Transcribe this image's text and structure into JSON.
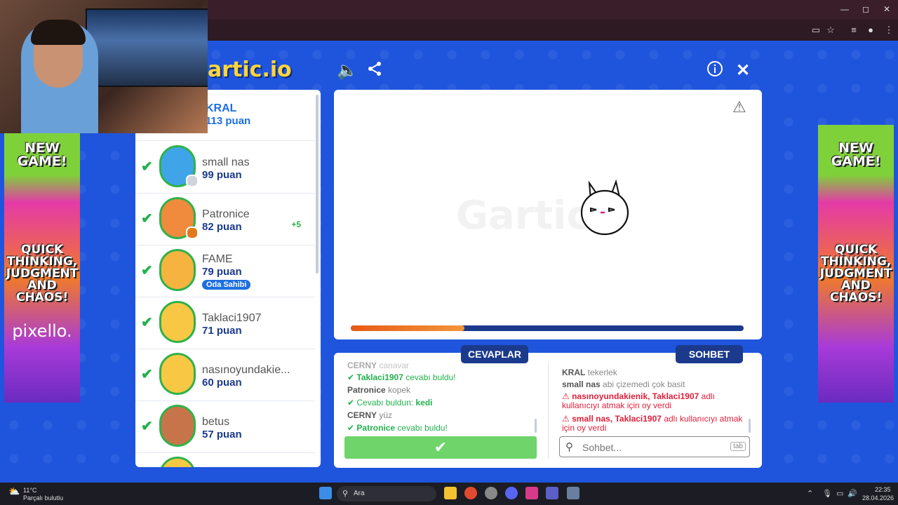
{
  "window": {
    "minimize": "—",
    "maximize": "◻",
    "close": "✕"
  },
  "browser": {
    "icons": [
      "cast-icon",
      "star-icon",
      "menu-icon"
    ]
  },
  "ads": {
    "left": {
      "headline": "NEW GAME!",
      "tagline": "QUICK THINKING, JUDGMENT AND CHAOS!",
      "brand": "pixello."
    },
    "right": {
      "headline": "NEW GAME!",
      "tagline": "QUICK THINKING, JUDGMENT AND CHAOS!"
    }
  },
  "game": {
    "logo": "artic.io",
    "watermark": "Gartic",
    "progress_fraction": 0.29
  },
  "players": [
    {
      "name": "KRAL",
      "score": "113 puan",
      "partial": true
    },
    {
      "name": "small nas",
      "score": "99 puan",
      "checked": true,
      "avatar_color": "#3fa5e8",
      "dot": "#cfd4dc"
    },
    {
      "name": "Patronice",
      "score": "82 puan",
      "checked": true,
      "plus": "+5",
      "avatar_color": "#f08a3c",
      "dot": "#e07a1a"
    },
    {
      "name": "FAME",
      "score": "79 puan",
      "checked": true,
      "owner": "Oda Sahibi",
      "avatar_color": "#f6b340"
    },
    {
      "name": "Taklaci1907",
      "score": "71 puan",
      "checked": true,
      "avatar_color": "#f8c844"
    },
    {
      "name": "nasınoyundakie...",
      "score": "60 puan",
      "checked": true,
      "avatar_color": "#f8c844"
    },
    {
      "name": "betus",
      "score": "57 puan",
      "checked": true,
      "avatar_color": "#c8744a"
    }
  ],
  "answers": {
    "tab": "CEVAPLAR",
    "lines": [
      {
        "user": "CERNY",
        "text": "canavar",
        "kind": "plain"
      },
      {
        "user": "Taklaci1907",
        "text": "cevabı buldu!",
        "kind": "found"
      },
      {
        "user": "Patronice",
        "text": "kopek",
        "kind": "plain"
      },
      {
        "user": "",
        "text": "Cevabı buldun:",
        "answer": "kedi",
        "kind": "self"
      },
      {
        "user": "CERNY",
        "text": "yüz",
        "kind": "plain"
      },
      {
        "user": "Patronice",
        "text": "cevabı buldu!",
        "kind": "found"
      }
    ]
  },
  "chat": {
    "tab": "SOHBET",
    "placeholder": "Sohbet...",
    "tab_hint": "tab",
    "lines": [
      {
        "user": "KRAL",
        "text": "tekerlek",
        "kind": "plain"
      },
      {
        "user": "small nas",
        "text": "abi çizemedi çok basit",
        "kind": "plain"
      },
      {
        "users": "nasınoyundakienik, Taklaci1907",
        "text1": "adlı",
        "text2": "kullanıcıyı atmak için oy verdi",
        "kind": "vote"
      },
      {
        "users": "small nas, Taklaci1907",
        "text1": "adlı kullanıcıyı atmak",
        "text2": "için oy verdi",
        "kind": "vote"
      }
    ]
  },
  "taskbar": {
    "temp": "11°C",
    "weather": "Parçalı bulutlu",
    "search": "Ara",
    "time": "22:35",
    "date": "28.04.2026"
  }
}
